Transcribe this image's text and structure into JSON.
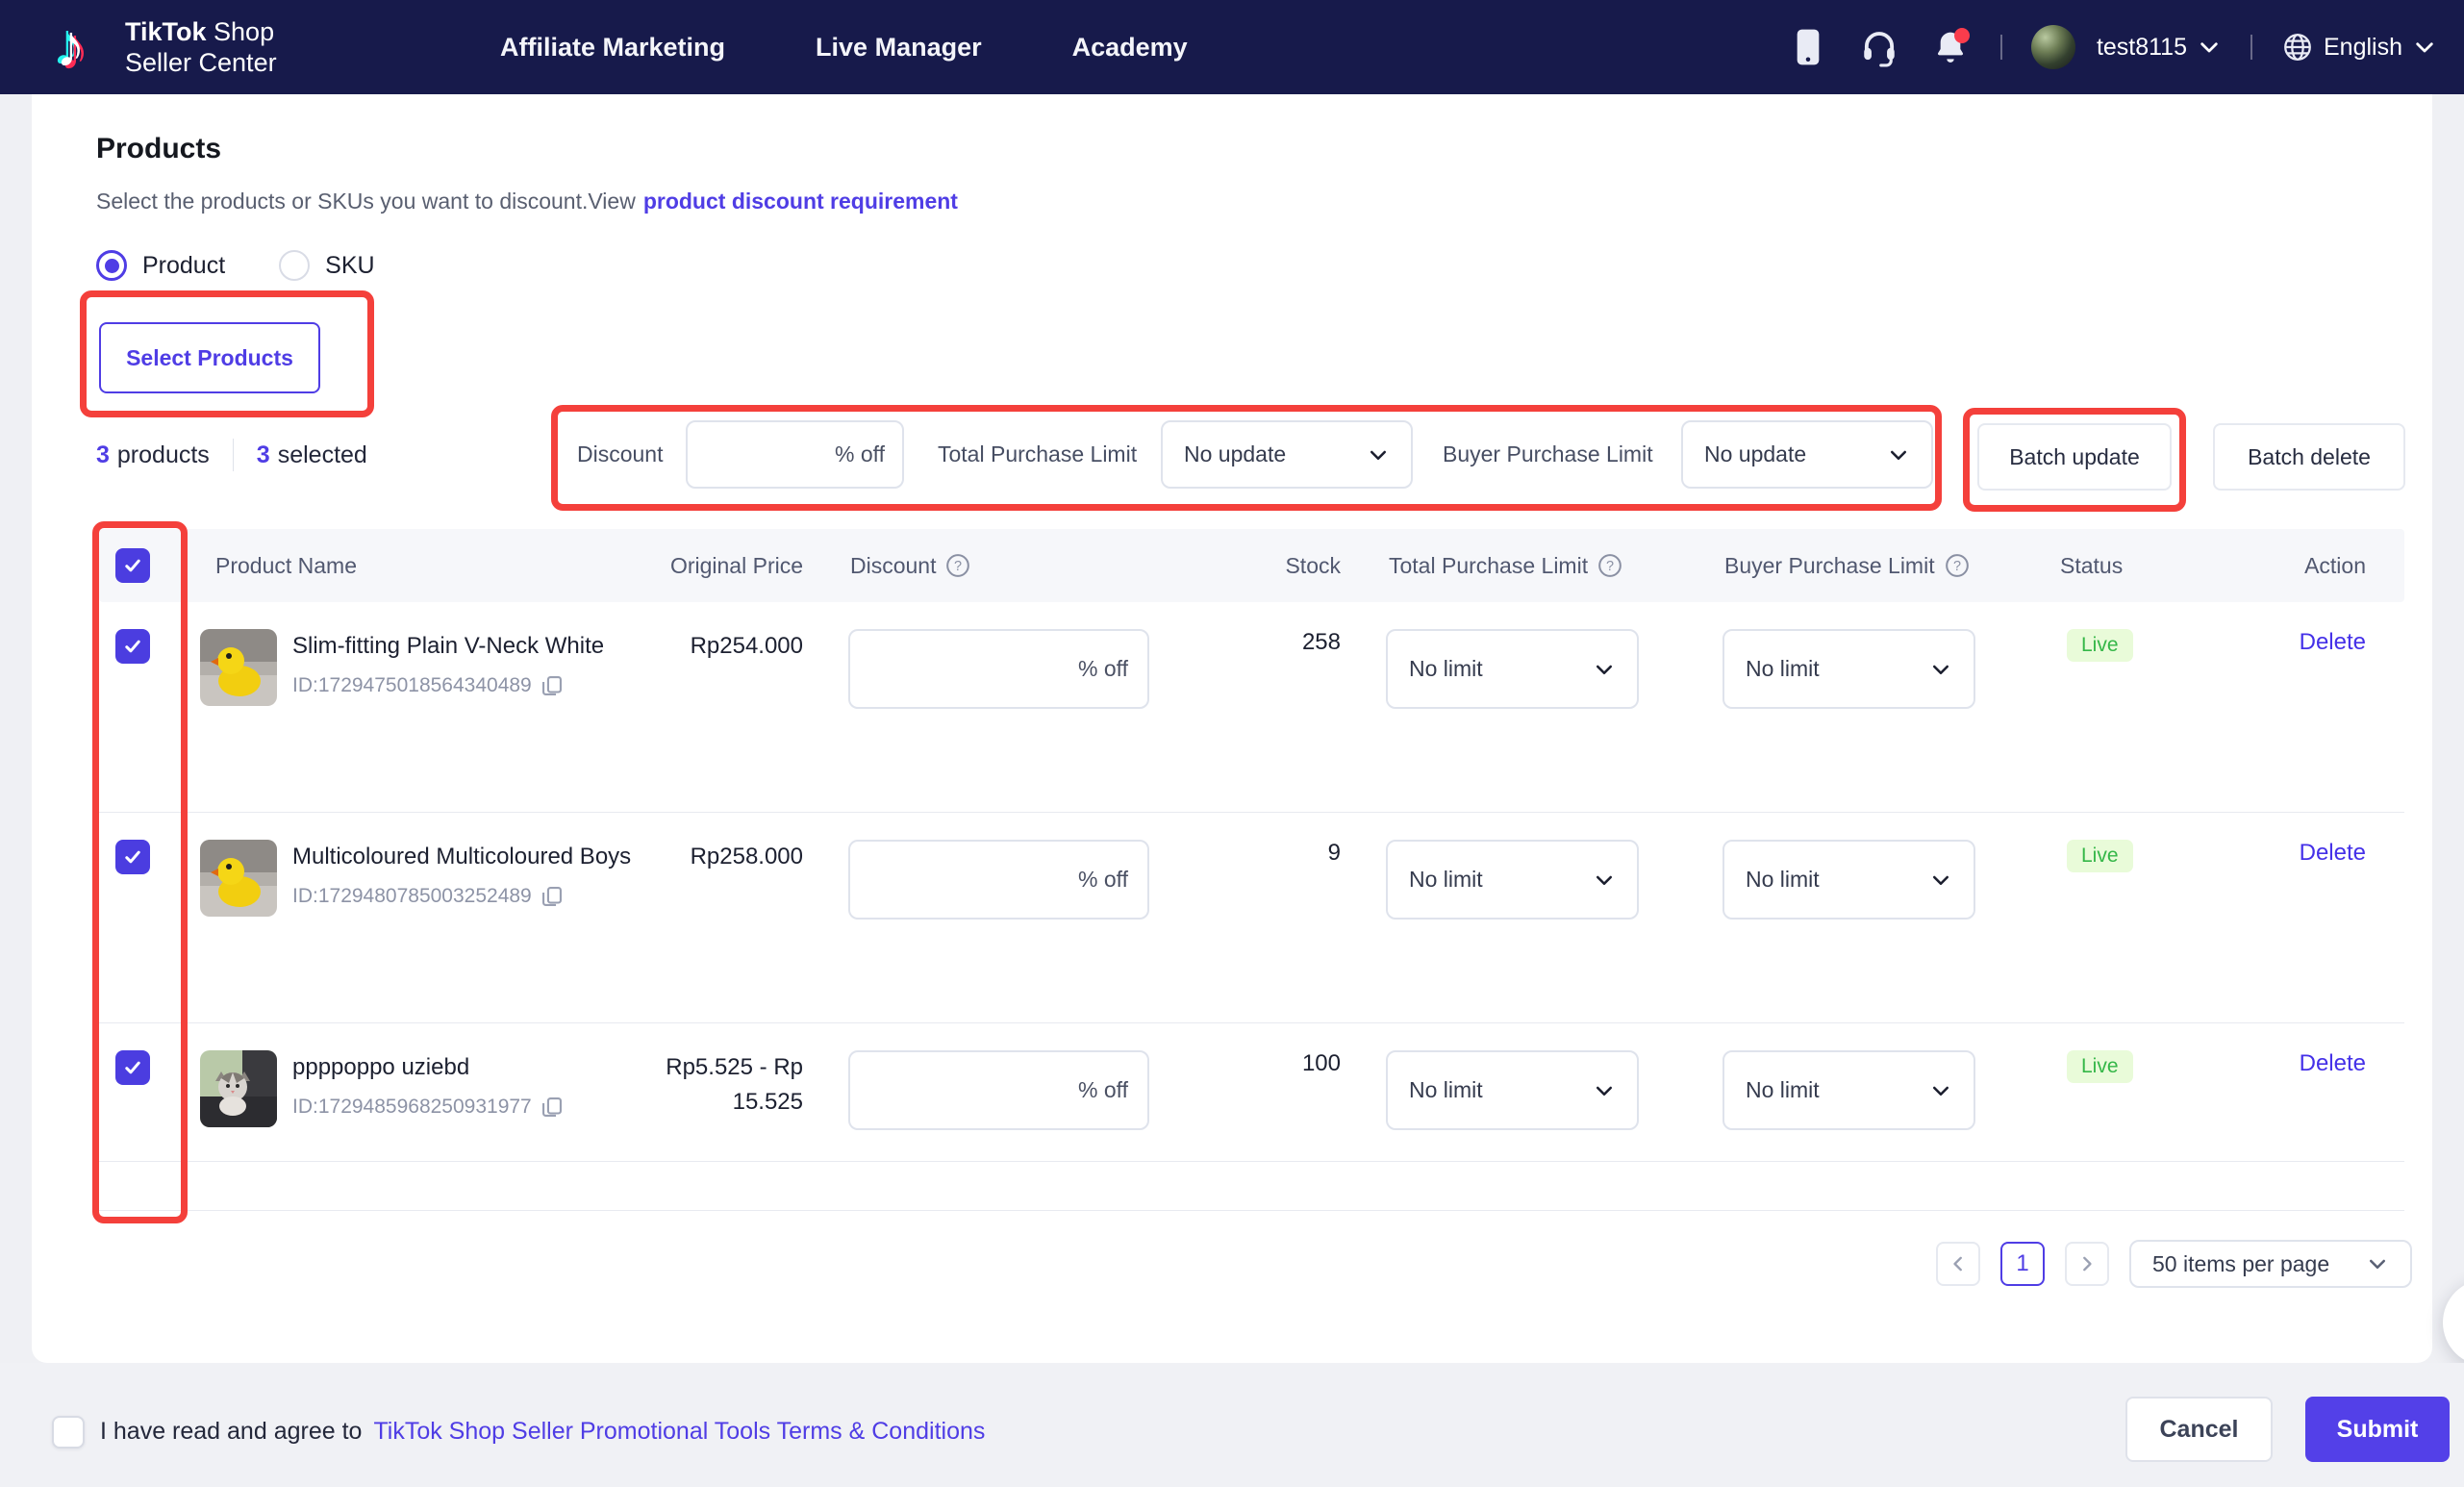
{
  "header": {
    "logo": {
      "brand_bold": "TikTok",
      "brand_light": " Shop",
      "line2": "Seller Center"
    },
    "nav": {
      "affiliate": "Affiliate Marketing",
      "live_manager": "Live Manager",
      "academy": "Academy"
    },
    "user": {
      "name": "test8115"
    },
    "language": {
      "label": "English"
    }
  },
  "products_section": {
    "title": "Products",
    "subtitle": "Select the products or SKUs you want to discount.View",
    "subtitle_link": "product discount requirement",
    "radio_product": "Product",
    "radio_sku": "SKU",
    "select_products_button": "Select Products",
    "counts": {
      "products_value": "3",
      "products_label": "products",
      "selected_value": "3",
      "selected_label": "selected"
    }
  },
  "batch_bar": {
    "discount_label": "Discount",
    "discount_suffix": "% off",
    "total_purchase_limit_label": "Total Purchase Limit",
    "total_purchase_limit_value": "No update",
    "buyer_purchase_limit_label": "Buyer Purchase Limit",
    "buyer_purchase_limit_value": "No update",
    "batch_update_button": "Batch update",
    "batch_delete_button": "Batch delete"
  },
  "table": {
    "discount_suffix": "% off",
    "headers": {
      "product_name": "Product Name",
      "original_price": "Original Price",
      "discount": "Discount",
      "stock": "Stock",
      "total_purchase_limit": "Total Purchase Limit",
      "buyer_purchase_limit": "Buyer Purchase Limit",
      "status": "Status",
      "action": "Action"
    },
    "rows": [
      {
        "name": "Slim-fitting Plain V-Neck White",
        "id": "ID:1729475018564340489",
        "price": "Rp254.000",
        "stock": "258",
        "total_limit": "No limit",
        "buyer_limit": "No limit",
        "status": "Live",
        "action": "Delete"
      },
      {
        "name": "Multicoloured Multicoloured Boys",
        "id": "ID:1729480785003252489",
        "price": "Rp258.000",
        "stock": "9",
        "total_limit": "No limit",
        "buyer_limit": "No limit",
        "status": "Live",
        "action": "Delete"
      },
      {
        "name": "ppppoppo uziebd",
        "id": "ID:1729485968250931977",
        "price": "Rp5.525 - Rp15.525",
        "stock": "100",
        "total_limit": "No limit",
        "buyer_limit": "No limit",
        "status": "Live",
        "action": "Delete"
      }
    ]
  },
  "pagination": {
    "current_page": "1",
    "page_size": "50 items per page"
  },
  "footer": {
    "agree_text": "I have read and agree to",
    "terms_link": "TikTok Shop Seller Promotional Tools Terms & Conditions",
    "cancel_button": "Cancel",
    "submit_button": "Submit"
  },
  "colors": {
    "accent_purple": "#4F3DE5",
    "annotation_red": "#F4403B",
    "header_navy": "#171A4B",
    "live_text": "#35B748",
    "live_bg": "#E9FBD9",
    "submit_purple": "#5340E8"
  }
}
